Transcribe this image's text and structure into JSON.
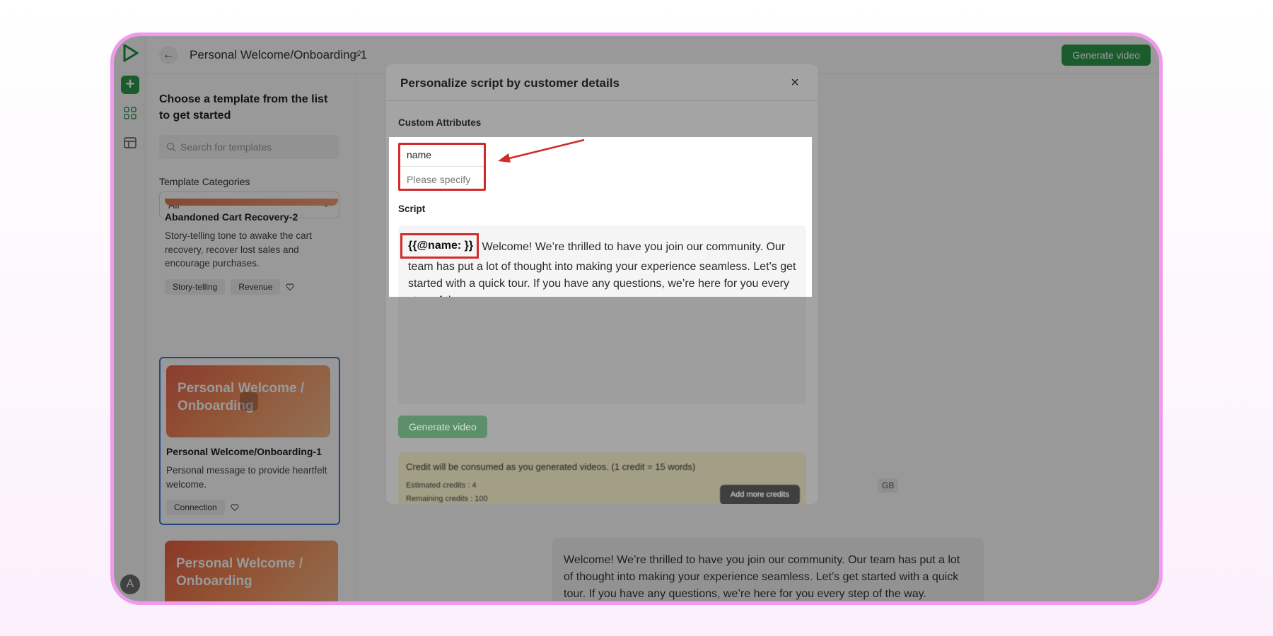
{
  "header": {
    "title": "Personal Welcome/Onboarding-1",
    "generate_label": "Generate video"
  },
  "rail": {
    "avatar_initial": "A"
  },
  "panel": {
    "heading": "Choose a template from the list to get started",
    "search_placeholder": "Search for templates",
    "categories_label": "Template Categories",
    "category_value": "All",
    "cards": [
      {
        "title": "Abandoned Cart Recovery-2",
        "desc": "Story-telling tone to awake the cart recovery, recover lost sales and encourage purchases.",
        "tags": [
          "Story-telling",
          "Revenue"
        ]
      },
      {
        "thumb_text": "Personal Welcome / Onboarding",
        "title": "Personal Welcome/Onboarding-1",
        "desc": "Personal message to provide heartfelt welcome.",
        "tags": [
          "Connection"
        ]
      },
      {
        "thumb_text": "Personal Welcome / Onboarding"
      }
    ]
  },
  "background": {
    "size_badge": "GB",
    "script_text": "Welcome! We’re thrilled to have you join our community. Our team has put a lot of thought into making your experience seamless. Let’s get started with a quick tour. If you have any questions, we’re here for you every step of the way."
  },
  "modal": {
    "title": "Personalize script by customer details",
    "close_glyph": "×",
    "attributes_label": "Custom Attributes",
    "attribute_name": "name",
    "attribute_placeholder": "Please specify",
    "script_label": "Script",
    "script_token": "{{@name: }}",
    "script_text": " Welcome! We’re thrilled to have you join our community. Our team has put a lot of thought into making your experience seamless. Let’s get started with a quick tour. If you have any questions, we’re here for you every step of the way.",
    "generate_label": "Generate video",
    "credits": {
      "line1": "Credit will be consumed as you generated videos. (1 credit = 15 words)",
      "line2": "Estimated credits : 4",
      "line3": "Remaining credits : 100",
      "button": "Add more credits"
    }
  },
  "colors": {
    "accent_green": "#2e9a4b",
    "highlight_red": "#d32a2a",
    "frame_pink": "#f199ee",
    "selected_blue": "#3b78d8"
  }
}
